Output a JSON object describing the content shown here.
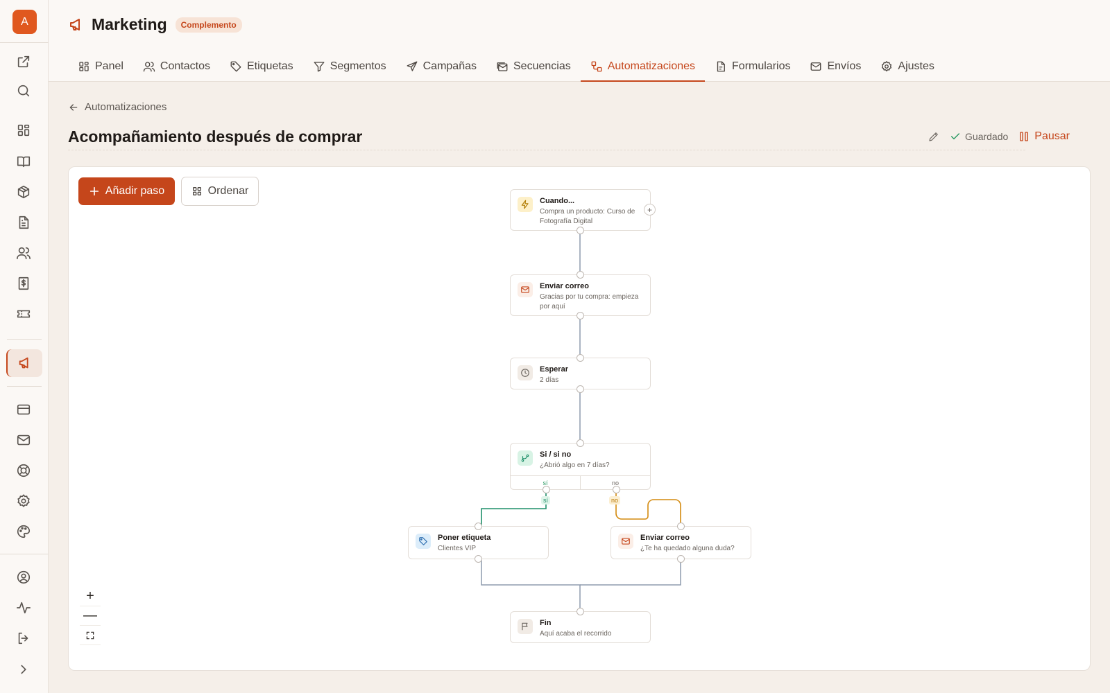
{
  "user": {
    "avatar_letter": "A"
  },
  "app": {
    "title": "Marketing",
    "badge": "Complemento"
  },
  "tabs": [
    {
      "label": "Panel",
      "icon": "grid-icon"
    },
    {
      "label": "Contactos",
      "icon": "users-icon"
    },
    {
      "label": "Etiquetas",
      "icon": "tag-icon"
    },
    {
      "label": "Segmentos",
      "icon": "filter-icon"
    },
    {
      "label": "Campañas",
      "icon": "send-icon"
    },
    {
      "label": "Secuencias",
      "icon": "mail-stack-icon"
    },
    {
      "label": "Automatizaciones",
      "icon": "workflow-icon",
      "active": true
    },
    {
      "label": "Formularios",
      "icon": "form-icon"
    },
    {
      "label": "Envíos",
      "icon": "mail-icon"
    },
    {
      "label": "Ajustes",
      "icon": "gear-icon"
    }
  ],
  "breadcrumb": {
    "back_label": "Automatizaciones"
  },
  "page": {
    "title": "Acompañamiento después de comprar",
    "saved_label": "Guardado",
    "pause_label": "Pausar"
  },
  "toolbar": {
    "add_step_label": "Añadir paso",
    "order_label": "Ordenar"
  },
  "flow": {
    "trigger": {
      "title": "Cuando...",
      "subtitle": "Compra un producto: Curso de Fotografía Digital",
      "add_symbol": "+"
    },
    "email1": {
      "title": "Enviar correo",
      "subtitle": "Gracias por tu compra: empieza por aquí"
    },
    "wait": {
      "title": "Esperar",
      "subtitle": "2 días"
    },
    "condition": {
      "title": "Si / si no",
      "subtitle": "¿Abrió algo en 7 días?",
      "yes_label": "sí",
      "no_label": "no"
    },
    "tag": {
      "title": "Poner etiqueta",
      "subtitle": "Clientes VIP"
    },
    "email2": {
      "title": "Enviar correo",
      "subtitle": "¿Te ha quedado alguna duda?"
    },
    "end": {
      "title": "Fin",
      "subtitle": "Aquí acaba el recorrido"
    }
  },
  "zoom": {
    "in_symbol": "+",
    "out_symbol": "—"
  },
  "colors": {
    "accent": "#c5461b",
    "yes_branch": "#1f8f6a",
    "no_branch": "#d48a0f",
    "connector": "#8e9bad"
  }
}
